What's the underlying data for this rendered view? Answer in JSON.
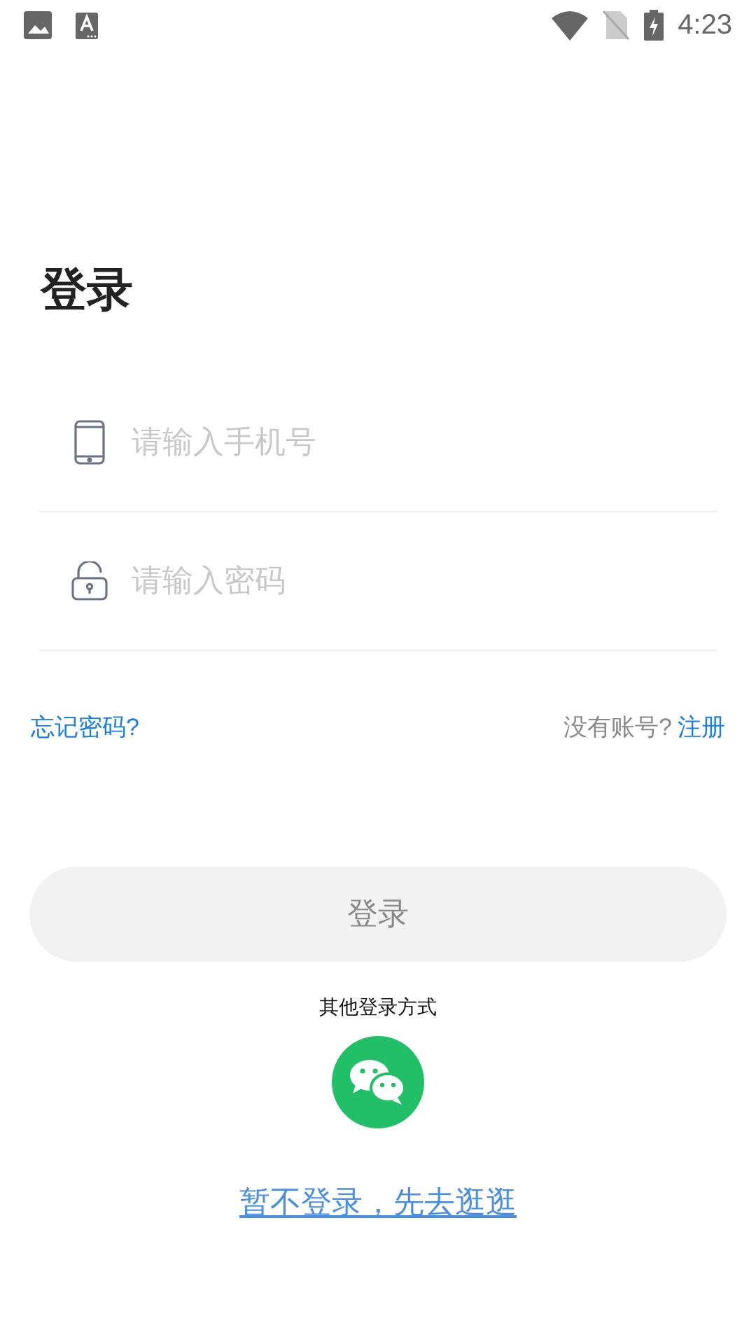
{
  "status_bar": {
    "time": "4:23"
  },
  "title": "登录",
  "fields": [
    {
      "kind": "phone",
      "placeholder": "请输入手机号"
    },
    {
      "kind": "password",
      "placeholder": "请输入密码"
    }
  ],
  "forgot_link": "忘记密码?",
  "register_prompt": "没有账号?",
  "register_link": "注册",
  "login_button": "登录",
  "other_methods_label": "其他登录方式",
  "skip_link": "暂不登录，先去逛逛"
}
